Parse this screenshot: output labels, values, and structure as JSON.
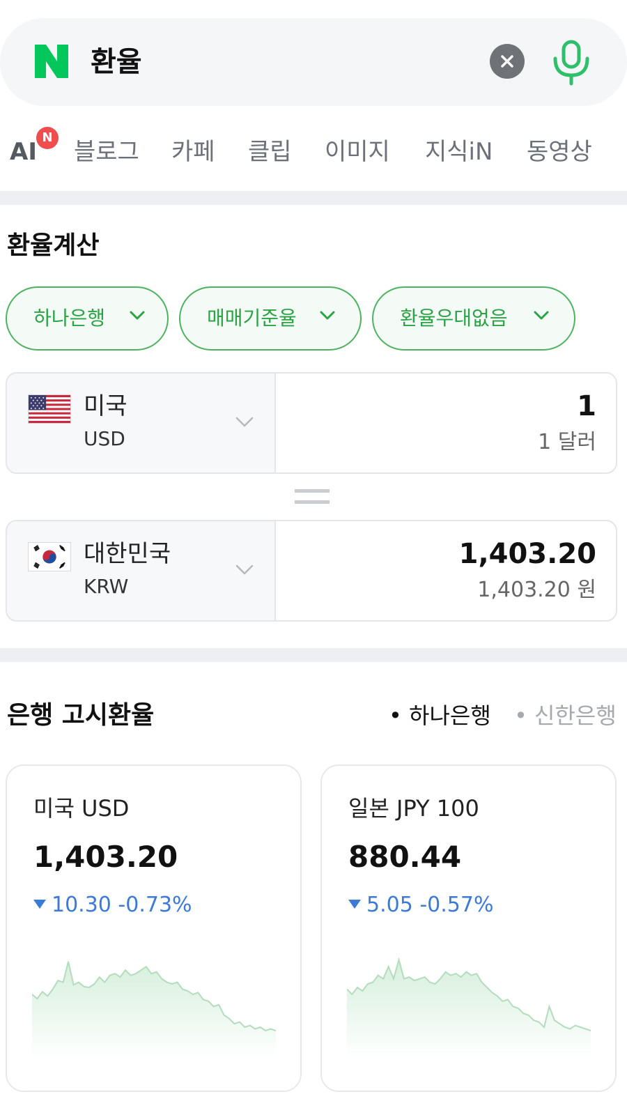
{
  "search": {
    "logo_letter": "N",
    "query": "환율",
    "brand_color": "#03c75a"
  },
  "tabs": {
    "ai_label": "AI",
    "ai_badge": "N",
    "items": [
      "블로그",
      "카페",
      "클립",
      "이미지",
      "지식iN",
      "동영상"
    ]
  },
  "calculator": {
    "title": "환율계산",
    "chips": [
      {
        "label": "하나은행"
      },
      {
        "label": "매매기준율"
      },
      {
        "label": "환율우대없음"
      }
    ],
    "from": {
      "country": "미국",
      "code": "USD",
      "amount": "1",
      "amount_text": "1 달러"
    },
    "to": {
      "country": "대한민국",
      "code": "KRW",
      "amount": "1,403.20",
      "amount_text": "1,403.20 원"
    }
  },
  "bank_rates": {
    "title": "은행 고시환율",
    "bank_options": [
      {
        "label": "• 하나은행",
        "active": true
      },
      {
        "label": "• 신한은행",
        "active": false
      }
    ],
    "cards": [
      {
        "title": "미국 USD",
        "value": "1,403.20",
        "change": "10.30 -0.73%",
        "direction": "down",
        "sparkline": [
          58,
          63,
          55,
          60,
          52,
          42,
          44,
          20,
          47,
          44,
          49,
          50,
          46,
          38,
          44,
          36,
          34,
          38,
          30,
          36,
          34,
          30,
          26,
          34,
          32,
          40,
          44,
          46,
          44,
          52,
          54,
          58,
          56,
          64,
          66,
          72,
          70,
          82,
          86,
          92,
          90,
          96,
          94,
          98,
          96,
          100,
          98,
          100
        ]
      },
      {
        "title": "일본 JPY 100",
        "value": "880.44",
        "change": "5.05 -0.57%",
        "direction": "down",
        "sparkline": [
          52,
          58,
          50,
          54,
          46,
          44,
          36,
          40,
          26,
          40,
          18,
          40,
          38,
          42,
          40,
          38,
          44,
          46,
          40,
          32,
          36,
          34,
          38,
          32,
          36,
          34,
          44,
          50,
          56,
          60,
          66,
          64,
          72,
          74,
          80,
          82,
          88,
          90,
          96,
          72,
          88,
          92,
          96,
          98,
          94,
          96,
          98,
          100
        ]
      }
    ]
  },
  "colors": {
    "green": "#2aa344",
    "down_blue": "#3c7ad8",
    "spark_line": "#b3dcbd"
  }
}
